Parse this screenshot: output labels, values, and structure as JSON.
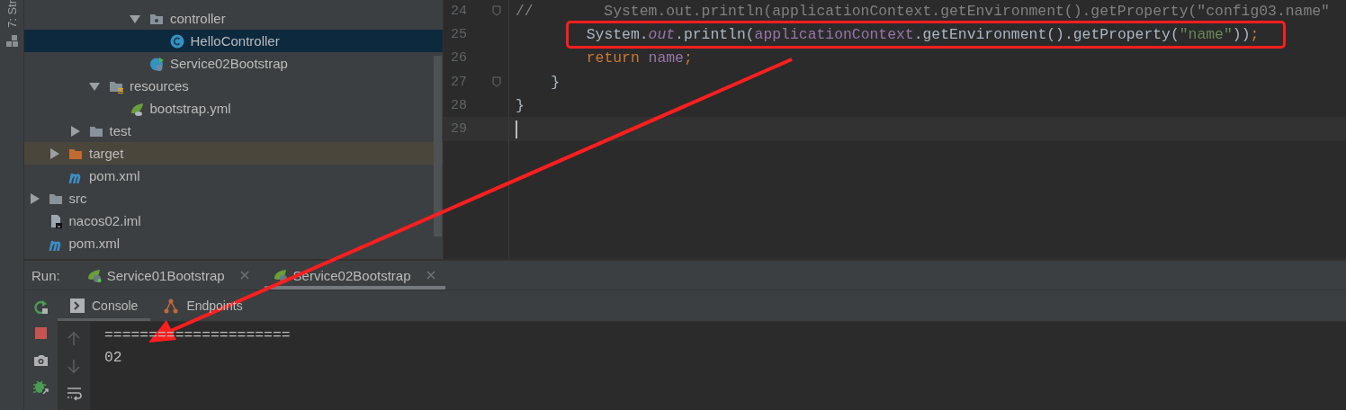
{
  "side_stripe": {
    "label": "7: Str"
  },
  "tree": {
    "items": [
      {
        "children": [
          {
            "children": [
              {
                "children": [
                  {
                    "children": [
                      {
                        "children": [
                          {
                            "label": "controller",
                            "kind": "package",
                            "expanded": true,
                            "selected": false,
                            "children": [
                              {
                                "label": "HelloController",
                                "kind": "class",
                                "selected": true
                              }
                            ]
                          },
                          {
                            "label": "Service02Bootstrap",
                            "kind": "boot-class",
                            "selected": false
                          }
                        ]
                      }
                    ]
                  },
                  {
                    "label": "resources",
                    "kind": "resources",
                    "expanded": true,
                    "selected": false,
                    "children": [
                      {
                        "label": "bootstrap.yml",
                        "kind": "yml",
                        "selected": false
                      }
                    ]
                  }
                ]
              },
              {
                "label": "test",
                "kind": "folder",
                "expanded": false,
                "selected": false
              }
            ]
          },
          {
            "label": "target",
            "kind": "excluded",
            "expanded": false,
            "selected": false
          },
          {
            "label": "pom.xml",
            "kind": "maven",
            "selected": false
          }
        ]
      },
      {
        "label": "src",
        "kind": "folder",
        "expanded": false,
        "selected": false
      },
      {
        "label": "nacos02.iml",
        "kind": "iml",
        "selected": false
      },
      {
        "label": "pom.xml",
        "kind": "maven",
        "selected": false
      }
    ]
  },
  "editor": {
    "lines": [
      {
        "number": "24",
        "fold": true,
        "current": false,
        "highlighted": false,
        "tokens": [
          {
            "kind": "comment",
            "text": "//        System.out.println(applicationContext.getEnvironment().getProperty(\"config03.name\""
          }
        ]
      },
      {
        "number": "25",
        "fold": false,
        "current": false,
        "highlighted": true,
        "tokens": [
          {
            "kind": "plain",
            "text": "        System."
          },
          {
            "kind": "static",
            "text": "out"
          },
          {
            "kind": "plain",
            "text": ".println("
          },
          {
            "kind": "field",
            "text": "applicationContext"
          },
          {
            "kind": "plain",
            "text": ".getEnvironment().getProperty("
          },
          {
            "kind": "string",
            "text": "\"name\""
          },
          {
            "kind": "plain",
            "text": "))"
          },
          {
            "kind": "keyword",
            "text": ";"
          }
        ]
      },
      {
        "number": "26",
        "fold": false,
        "current": false,
        "highlighted": false,
        "tokens": [
          {
            "kind": "keyword",
            "text": "        return "
          },
          {
            "kind": "field",
            "text": "name"
          },
          {
            "kind": "keyword",
            "text": ";"
          }
        ]
      },
      {
        "number": "27",
        "fold": true,
        "current": false,
        "highlighted": false,
        "tokens": [
          {
            "kind": "plain",
            "text": "    }"
          }
        ]
      },
      {
        "number": "28",
        "fold": false,
        "current": false,
        "highlighted": false,
        "tokens": [
          {
            "kind": "plain",
            "text": "}"
          }
        ]
      },
      {
        "number": "29",
        "fold": false,
        "current": true,
        "highlighted": false
      }
    ]
  },
  "run": {
    "label": "Run:",
    "tabs": [
      {
        "label": "Service01Bootstrap",
        "selected": false
      },
      {
        "label": "Service02Bootstrap",
        "selected": true
      }
    ],
    "subtabs": [
      {
        "label": "Console",
        "kind": "console",
        "selected": true
      },
      {
        "label": "Endpoints",
        "kind": "endpoints",
        "selected": false
      }
    ],
    "console_lines": [
      "=====================",
      "02"
    ]
  }
}
